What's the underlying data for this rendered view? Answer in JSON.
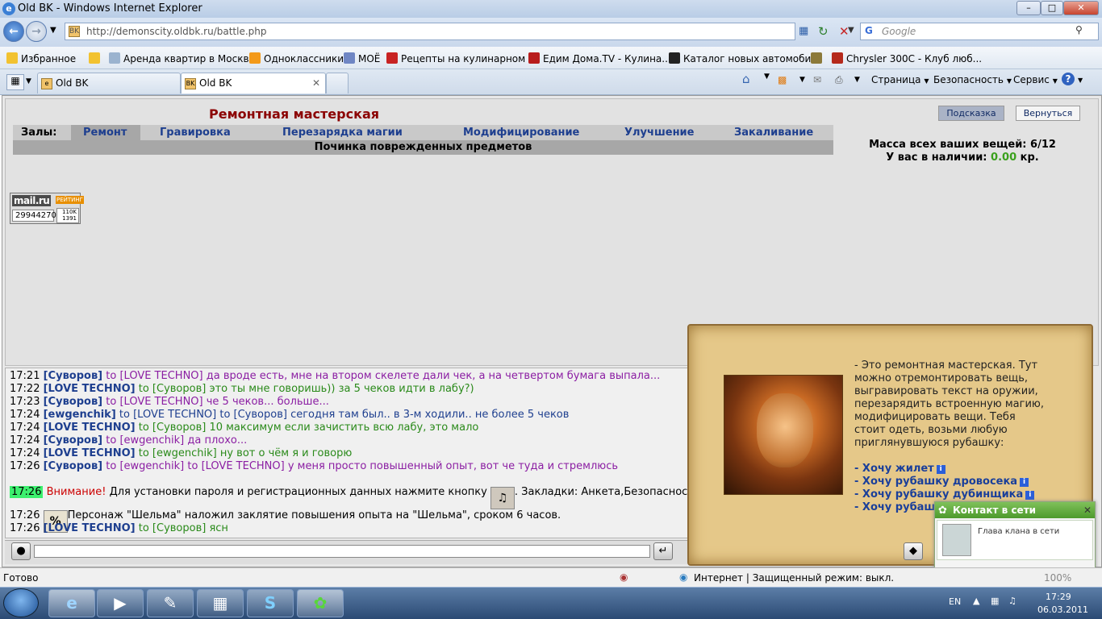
{
  "window": {
    "title": "Old BK - Windows Internet Explorer"
  },
  "nav": {
    "url": "http://demonscity.oldbk.ru/battle.php",
    "search_placeholder": "Google"
  },
  "favorites": {
    "label": "Избранное",
    "items": [
      "Аренда квартир в Москв...",
      "Одноклассники",
      "МОЁ",
      "Рецепты на кулинарном ...",
      "Едим Дома.TV - Кулина...",
      "Каталог новых автомоби...",
      "Chrysler 300C - Клуб люб..."
    ]
  },
  "tabs": [
    {
      "label": "Old BK"
    },
    {
      "label": "Old BK"
    }
  ],
  "commands": {
    "page": "Страница",
    "safety": "Безопасность",
    "service": "Сервис"
  },
  "shop": {
    "title": "Ремонтная мастерская",
    "hint_button": "Подсказка",
    "back_button": "Вернуться",
    "halls_label": "Залы:",
    "halls": [
      "Ремонт",
      "Гравировка",
      "Перезарядка магии",
      "Модифицирование",
      "Улучшение",
      "Закаливание"
    ],
    "active_hall": "Ремонт",
    "subtitle": "Починка поврежденных предметов",
    "mass_text": "Масса всех ваших вещей: 6/12",
    "money_label": "У вас в наличии:",
    "money_value": "0.00",
    "money_unit": "кр."
  },
  "counter": {
    "logo": "mail.ru",
    "badge": "РЕЙТИНГ",
    "count": "29944270",
    "stat1": "110K",
    "stat2": "1391"
  },
  "chat": {
    "lines": [
      {
        "time": "17:21",
        "from": "[Суворов]",
        "text": "to [LOVE TECHNO] да вроде есть, мне на втором скелете дали чек, а на четвертом бумага выпала...",
        "color": "p"
      },
      {
        "time": "17:22",
        "from": "[LOVE TECHNO]",
        "text": "to [Суворов] это ты мне говоришь)) за 5 чеков идти в лабу?)",
        "color": "g"
      },
      {
        "time": "17:23",
        "from": "[Суворов]",
        "text": "to [LOVE TECHNO] че 5 чеков... больше...",
        "color": "p"
      },
      {
        "time": "17:24",
        "from": "[ewgenchik]",
        "text": "to [LOVE TECHNO] to [Суворов] сегодня там был.. в 3-м ходили.. не более 5 чеков",
        "color": "b"
      },
      {
        "time": "17:24",
        "from": "[LOVE TECHNO]",
        "text": "to [Суворов] 10 максимум если зачистить всю лабу, это мало",
        "color": "g"
      },
      {
        "time": "17:24",
        "from": "[Суворов]",
        "text": "to [ewgenchik] да плохо...",
        "color": "p"
      },
      {
        "time": "17:24",
        "from": "[LOVE TECHNO]",
        "text": "to [ewgenchik] ну вот о чём я и говорю",
        "color": "g"
      },
      {
        "time": "17:26",
        "from": "[Суворов]",
        "text": "to [ewgenchik] to [LOVE TECHNO] у меня просто повышенный опыт, вот че туда и стремлюсь",
        "color": "p"
      }
    ],
    "system_time": "17:26",
    "warning_label": "Внимание!",
    "warning_text": "Для установки пароля и регистрационных данных нажмите кнопку",
    "warning_tail": ". Закладки: Анкета,Безопасность",
    "spell_time": "17:26",
    "spell_text": "Персонаж \"Шельма\" наложил заклятие повышения опыта на \"Шельма\", сроком 6 часов.",
    "last": {
      "time": "17:26",
      "from": "[LOVE TECHNO]",
      "text": "to [Суворов] ясн"
    }
  },
  "scroll": {
    "text": "- Это ремонтная мастерская. Тут можно отремонтировать вещь, выгравировать текст на оружии, перезарядить встроенную магию, модифицировать вещи. Тебя стоит одеть, возьми любую приглянувшуюся рубашку:",
    "wishes": [
      "- Хочу жилет",
      "- Хочу рубашку дровосека",
      "- Хочу рубашку дубинщика",
      "- Хочу рубаш"
    ]
  },
  "notification": {
    "title": "Контакт в сети",
    "message": "Глава клана в сети"
  },
  "status": {
    "left": "Готово",
    "zone": "Интернет | Защищенный режим: выкл.",
    "zoom": "100%"
  },
  "taskbar": {
    "lang": "EN",
    "time": "17:29",
    "date": "06.03.2011"
  }
}
